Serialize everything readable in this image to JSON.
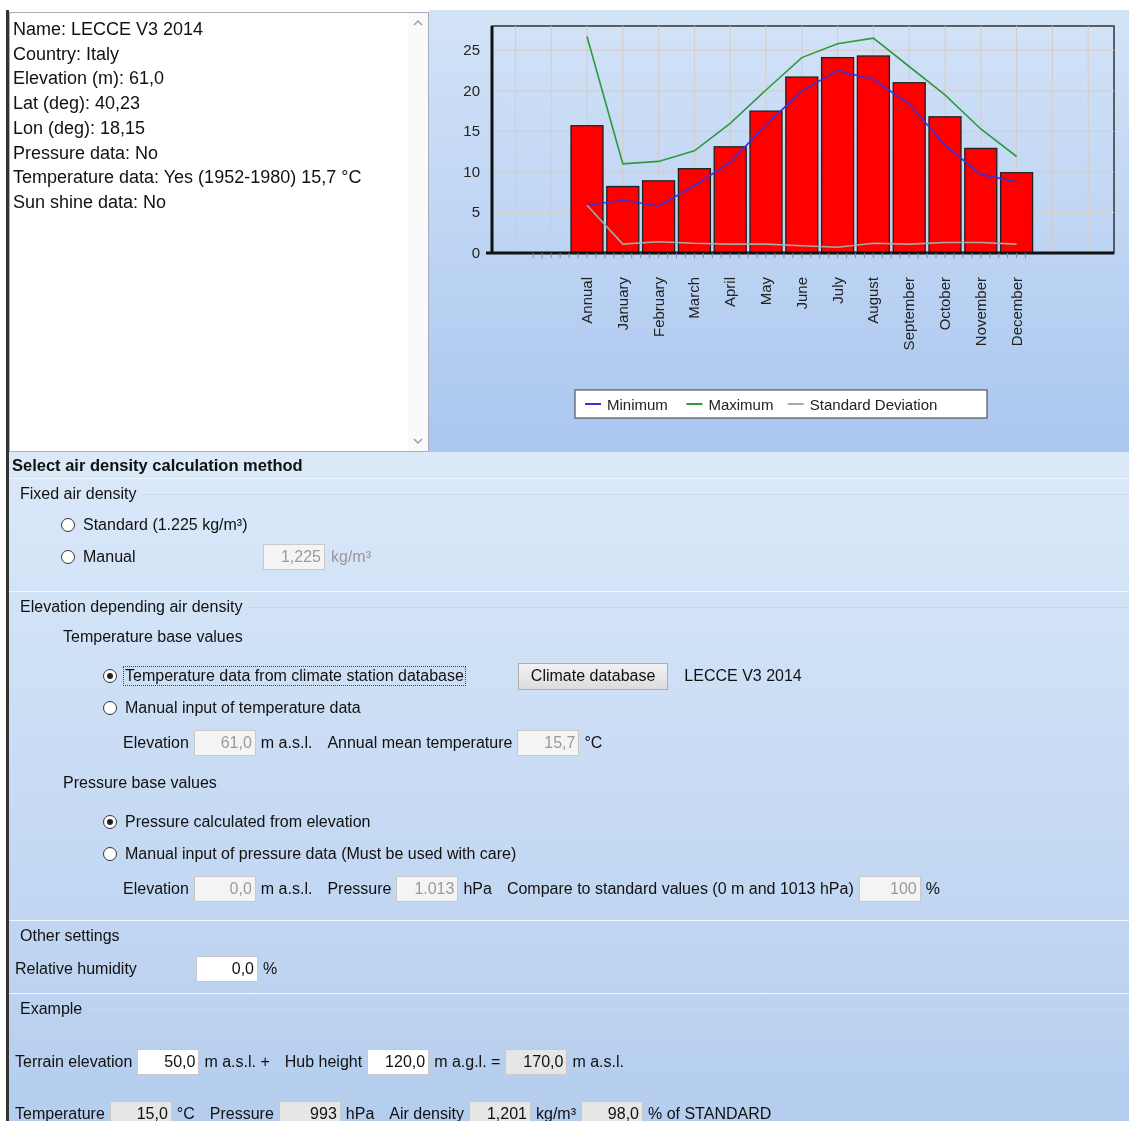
{
  "info_panel": {
    "lines": [
      "Name: LECCE V3 2014",
      "Country: Italy",
      "Elevation (m): 61,0",
      "Lat (deg): 40,23",
      "Lon (deg): 18,15",
      "Pressure data: No",
      "Temperature data: Yes (1952-1980) 15,7 °C",
      "Sun shine data: No"
    ]
  },
  "chart": {
    "chart_data": {
      "type": "bar",
      "categories": [
        "Annual",
        "January",
        "February",
        "March",
        "April",
        "May",
        "June",
        "July",
        "August",
        "September",
        "October",
        "November",
        "December"
      ],
      "ylim": [
        0,
        28
      ],
      "grid": true,
      "legend": true,
      "yticks": [
        0,
        5,
        10,
        15,
        20,
        25
      ],
      "series": [
        {
          "color": "#ff0000",
          "values": [
            15.7,
            8.2,
            8.9,
            10.4,
            13.1,
            17.5,
            21.7,
            24.1,
            24.3,
            21.0,
            16.8,
            12.9,
            9.9
          ]
        },
        {
          "type": "line",
          "name": "Minimum",
          "color": "#3a2fd8",
          "values": [
            5.9,
            6.5,
            5.8,
            8.3,
            11.2,
            15.8,
            20.0,
            22.5,
            21.4,
            18.4,
            13.3,
            9.7,
            8.8
          ]
        },
        {
          "type": "line",
          "name": "Maximum",
          "color": "#2f9a3c",
          "values": [
            26.7,
            11.0,
            11.3,
            12.6,
            16.0,
            20.1,
            24.1,
            25.8,
            26.5,
            23.0,
            19.5,
            15.3,
            11.9
          ]
        },
        {
          "type": "line",
          "name": "Standard Deviation",
          "color": "#a8a8a8",
          "values": [
            5.9,
            1.1,
            1.4,
            1.2,
            1.1,
            1.1,
            0.9,
            0.7,
            1.2,
            1.1,
            1.3,
            1.3,
            1.1
          ]
        }
      ]
    }
  },
  "form": {
    "title": "Select air density calculation method",
    "sections": [
      {
        "title": "Fixed air density",
        "items": [
          {
            "kind": "radio",
            "label": "Standard (1.225 kg/m³)",
            "selected": false,
            "focused": false
          },
          {
            "kind": "radio",
            "label": "Manual",
            "selected": false,
            "focused": false,
            "field": {
              "value": "1,225",
              "disabled": true,
              "readonly": false
            },
            "unit": "kg/m³"
          }
        ]
      },
      {
        "title": "Elevation depending air density",
        "subsections": [
          {
            "title": "Temperature base values",
            "items": [
              {
                "kind": "radio",
                "label": "Temperature data from climate station database",
                "selected": true,
                "focused": true,
                "button": "Climate database",
                "note": "LECCE V3 2014"
              },
              {
                "kind": "radio",
                "label": "Manual input of temperature data",
                "selected": false,
                "focused": false
              },
              {
                "kind": "inputs",
                "parts": [
                  {
                    "kind": "label",
                    "text": "Elevation"
                  },
                  {
                    "kind": "field",
                    "value": "61,0",
                    "disabled": true,
                    "readonly": false
                  },
                  {
                    "kind": "label",
                    "text": "m a.s.l."
                  },
                  {
                    "kind": "label",
                    "text": "Annual mean temperature"
                  },
                  {
                    "kind": "field",
                    "value": "15,7",
                    "disabled": true,
                    "readonly": false
                  },
                  {
                    "kind": "label",
                    "text": "°C"
                  }
                ]
              }
            ]
          },
          {
            "title": "Pressure base values",
            "items": [
              {
                "kind": "radio",
                "label": "Pressure calculated from elevation",
                "selected": true,
                "focused": false
              },
              {
                "kind": "radio",
                "label": "Manual input of pressure data (Must be used with care)",
                "selected": false,
                "focused": false
              },
              {
                "kind": "inputs",
                "parts": [
                  {
                    "kind": "label",
                    "text": "Elevation"
                  },
                  {
                    "kind": "field",
                    "value": "0,0",
                    "disabled": true,
                    "readonly": false
                  },
                  {
                    "kind": "label",
                    "text": "m a.s.l."
                  },
                  {
                    "kind": "label",
                    "text": "Pressure"
                  },
                  {
                    "kind": "field",
                    "value": "1.013",
                    "disabled": true,
                    "readonly": false
                  },
                  {
                    "kind": "label",
                    "text": "hPa"
                  },
                  {
                    "kind": "label",
                    "text": "Compare to standard values (0 m and 1013 hPa)"
                  },
                  {
                    "kind": "field",
                    "value": "100",
                    "disabled": true,
                    "readonly": false
                  },
                  {
                    "kind": "label",
                    "text": "%"
                  }
                ]
              }
            ]
          }
        ]
      },
      {
        "title": "Other settings",
        "items": [
          {
            "kind": "inputs",
            "parts": [
              {
                "kind": "label",
                "text": "Relative humidity"
              },
              {
                "kind": "field",
                "value": "0,0",
                "disabled": false,
                "readonly": false
              },
              {
                "kind": "label",
                "text": "%"
              }
            ]
          }
        ]
      },
      {
        "title": "Example",
        "items": [
          {
            "kind": "inputs",
            "parts": [
              {
                "kind": "label",
                "text": "Terrain elevation"
              },
              {
                "kind": "field",
                "value": "50,0",
                "disabled": false,
                "readonly": false
              },
              {
                "kind": "label",
                "text": "m a.s.l. +"
              },
              {
                "kind": "label",
                "text": "Hub height"
              },
              {
                "kind": "field",
                "value": "120,0",
                "disabled": false,
                "readonly": false
              },
              {
                "kind": "label",
                "text": "m a.g.l. ="
              },
              {
                "kind": "field",
                "value": "170,0",
                "disabled": false,
                "readonly": true
              },
              {
                "kind": "label",
                "text": "m a.s.l."
              }
            ]
          },
          {
            "kind": "inputs",
            "parts": [
              {
                "kind": "label",
                "text": "Temperature"
              },
              {
                "kind": "field",
                "value": "15,0",
                "disabled": false,
                "readonly": true
              },
              {
                "kind": "label",
                "text": "°C"
              },
              {
                "kind": "label",
                "text": "Pressure"
              },
              {
                "kind": "field",
                "value": "993",
                "disabled": false,
                "readonly": true
              },
              {
                "kind": "label",
                "text": "hPa"
              },
              {
                "kind": "label",
                "text": "Air density"
              },
              {
                "kind": "field",
                "value": "1,201",
                "disabled": false,
                "readonly": true
              },
              {
                "kind": "label",
                "text": "kg/m³"
              },
              {
                "kind": "field",
                "value": "98,0",
                "disabled": false,
                "readonly": true
              },
              {
                "kind": "label",
                "text": "% of STANDARD"
              }
            ]
          }
        ]
      }
    ]
  }
}
